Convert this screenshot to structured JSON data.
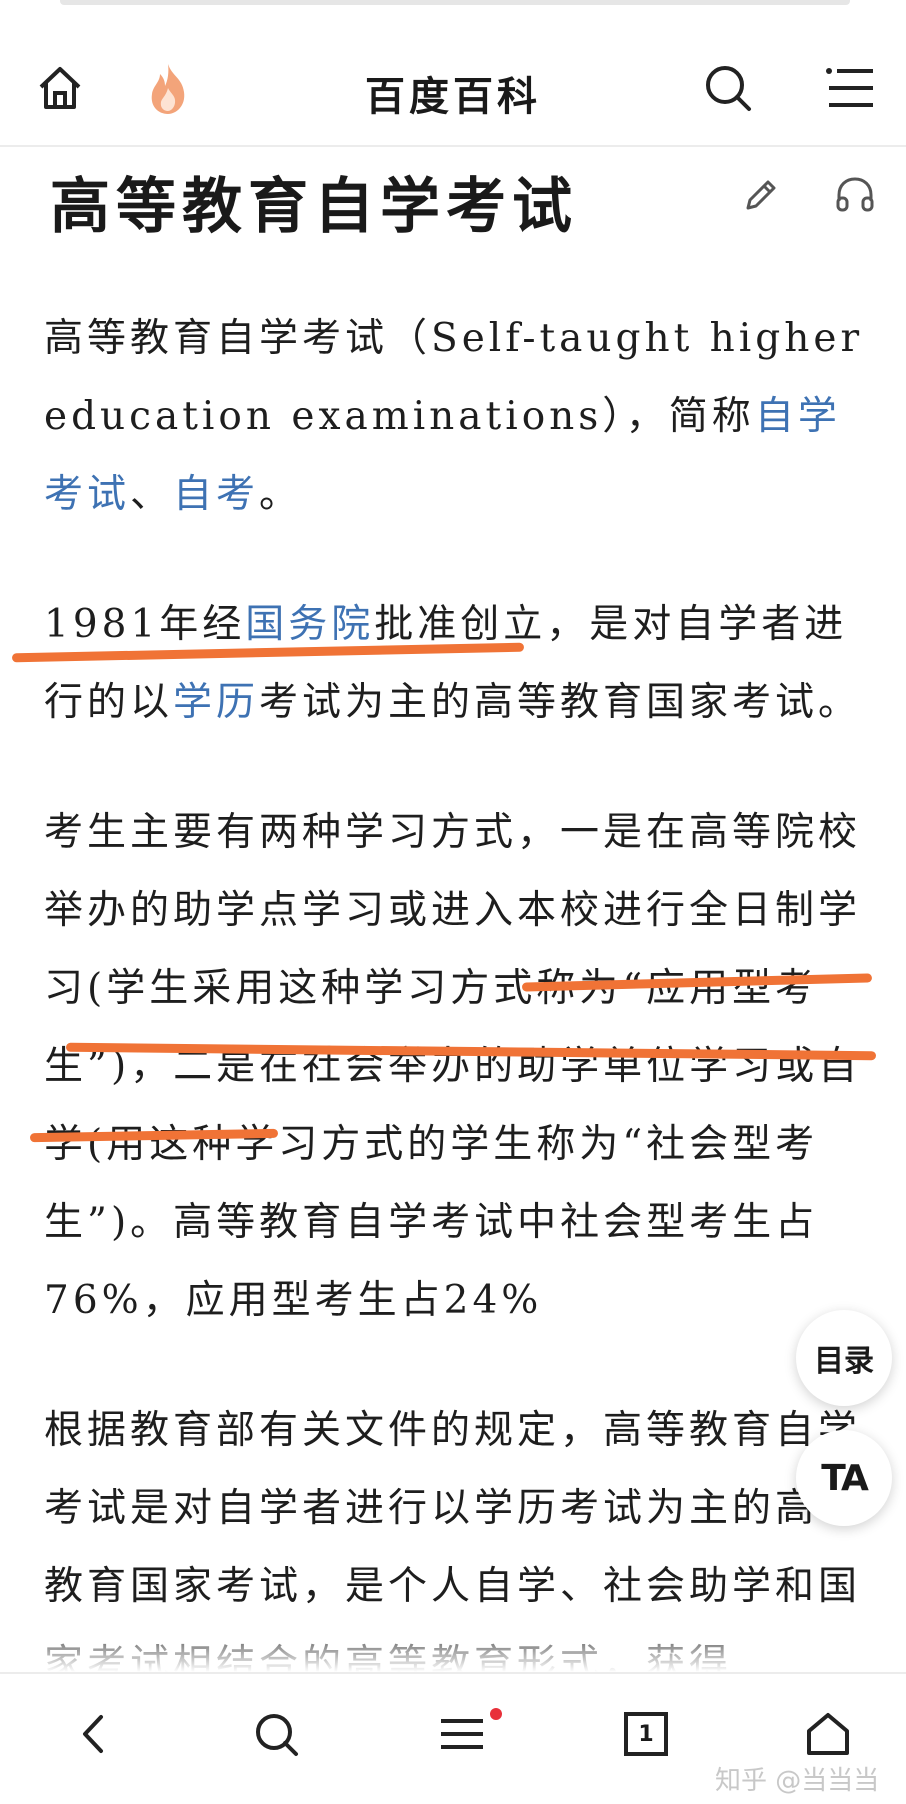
{
  "header": {
    "site_title": "百度百科"
  },
  "article": {
    "title": "高等教育自学考试",
    "p1": {
      "a": "高等教育自学考试（Self-taught higher education examinations），简称",
      "link1": "自学考试",
      "b": "、",
      "link2": "自考",
      "c": "。"
    },
    "p2": {
      "a": "1981年经",
      "link1": "国务院",
      "b": "批准创立，是对自学者进行的以",
      "link2": "学历",
      "c": "考试为主的高等教育国家考试。"
    },
    "p3": "考生主要有两种学习方式，一是在高等院校举办的助学点学习或进入本校进行全日制学习(学生采用这种学习方式称为“应用型考生”)，二是在社会举办的助学单位学习或自学(用这种学习方式的学生称为“社会型考生”)。高等教育自学考试中社会型考生占76%，应用型考生占24%",
    "p4": "根据教育部有关文件的规定，高等教育自学考试是对自学者进行以学历考试为主的高等教育国家考试，是个人自学、社会助学和国家考试相结合的高等教育形式，获得"
  },
  "floating": {
    "toc_label": "目录",
    "font_label": "TA"
  },
  "bottom_nav": {
    "tab_count": "1"
  },
  "watermark": "知乎 @当当当",
  "colors": {
    "link": "#3e72b3",
    "highlight": "#f07336",
    "logo": "#f3a47a"
  }
}
